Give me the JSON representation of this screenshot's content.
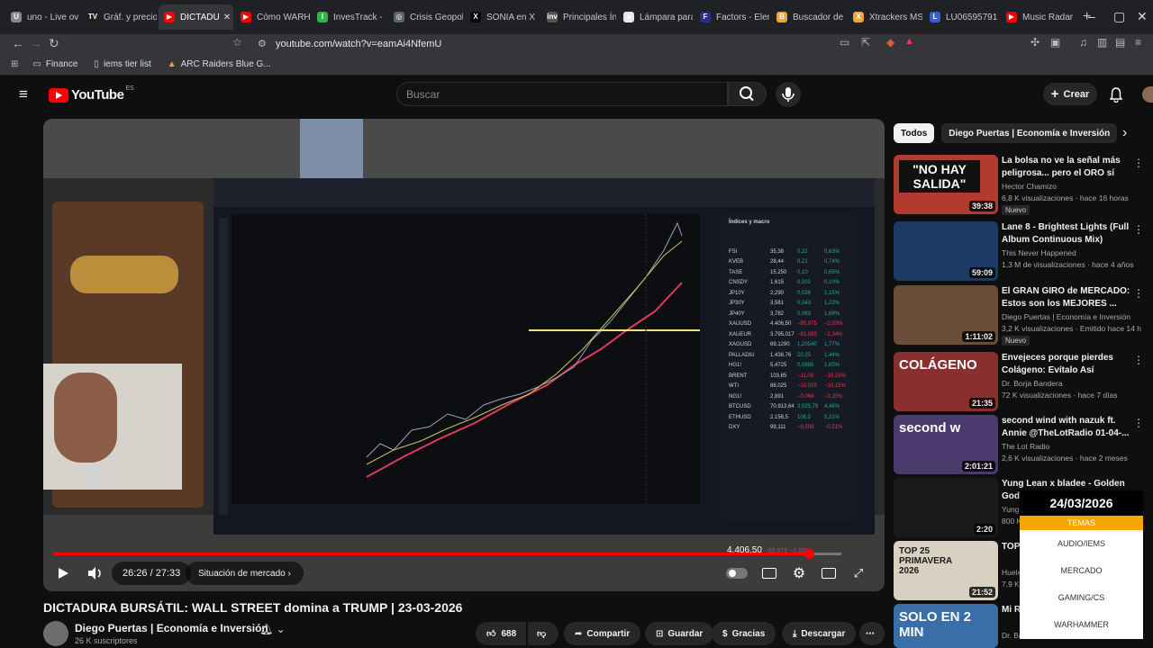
{
  "browser": {
    "tabs": [
      {
        "label": "uno - Live ov",
        "color": "#888888",
        "icon": "U"
      },
      {
        "label": "Gráf. y precio",
        "color": "#1e1e1e",
        "icon": "TV"
      },
      {
        "label": "DICTADU",
        "color": "#ff0000",
        "icon": "▶",
        "active": true
      },
      {
        "label": "Cómo WARH",
        "color": "#ff0000",
        "icon": "▶"
      },
      {
        "label": "InvesTrack -",
        "color": "#2fb34a",
        "icon": "I"
      },
      {
        "label": "Crisis Geopol",
        "color": "#5f6368",
        "icon": "◎"
      },
      {
        "label": "SONIA en X",
        "color": "#000000",
        "icon": "X"
      },
      {
        "label": "Principales Ín",
        "color": "#555555",
        "icon": "inv"
      },
      {
        "label": "Lámpara para",
        "color": "#e8e8e8",
        "icon": "a"
      },
      {
        "label": "Factors - Elem",
        "color": "#2a2f8a",
        "icon": "F"
      },
      {
        "label": "Buscador de",
        "color": "#f2a33a",
        "icon": "B"
      },
      {
        "label": "Xtrackers MS",
        "color": "#f2a33a",
        "icon": "X"
      },
      {
        "label": "LU06595791",
        "color": "#3b5bd6",
        "icon": "L"
      },
      {
        "label": "Music Radar",
        "color": "#ff0000",
        "icon": "▶"
      }
    ],
    "new_tab": "+",
    "minimize": "–",
    "maximize": "▢",
    "close": "✕",
    "url": "youtube.com/watch?v=eamAi4NfemU",
    "bookmarks": [
      "Finance",
      "iems tier list",
      "ARC Raiders Blue G..."
    ]
  },
  "youtube": {
    "logo_text": "YouTube",
    "region": "ES",
    "search_placeholder": "Buscar",
    "create_label": "Crear"
  },
  "player": {
    "current_time": "26:26",
    "duration": "27:33",
    "time_separator": "/",
    "progress": 0.959,
    "chapter": "Situación de mercado",
    "chapter_arrow": "›",
    "screen_price": "4.406,50",
    "screen_change": "−95,975   −2,03%",
    "watchlist_title": "Índices y macro",
    "watchlist": [
      {
        "sym": "FSI",
        "val": "35,38",
        "chg": "0,22",
        "pct": "0,63%"
      },
      {
        "sym": "KVEB",
        "val": "28,44",
        "chg": "0,21",
        "pct": "0,74%"
      },
      {
        "sym": "TASE",
        "val": "15.250",
        "chg": "0,10",
        "pct": "0,65%"
      },
      {
        "sym": "CNSDY",
        "val": "1,615",
        "chg": "0,001",
        "pct": "0,10%"
      },
      {
        "sym": "JP10Y",
        "val": "2,290",
        "chg": "0,026",
        "pct": "1,15%"
      },
      {
        "sym": "JP30Y",
        "val": "3,581",
        "chg": "0,043",
        "pct": "1,22%"
      },
      {
        "sym": "JP40Y",
        "val": "3,782",
        "chg": "0,063",
        "pct": "1,69%"
      },
      {
        "sym": "XAUUSD",
        "val": "4.406,50",
        "chg": "−95,975",
        "pct": "−2,03%"
      },
      {
        "sym": "XAUEUR",
        "val": "3.795,017",
        "chg": "−91,083",
        "pct": "−2,34%"
      },
      {
        "sym": "XAGUSD",
        "val": "69,1290",
        "chg": "1,20540",
        "pct": "1,77%"
      },
      {
        "sym": "PALLADIU",
        "val": "1.438,76",
        "chg": "20,25",
        "pct": "1,44%"
      },
      {
        "sym": "HG1!",
        "val": "5,4725",
        "chg": "0,0885",
        "pct": "1,65%"
      },
      {
        "sym": "BRENT",
        "val": "103,65",
        "chg": "−11,09",
        "pct": "−10,23%"
      },
      {
        "sym": "WTI",
        "val": "88,025",
        "chg": "−10,025",
        "pct": "−10,15%"
      },
      {
        "sym": "NG1!",
        "val": "2,891",
        "chg": "−0,094",
        "pct": "−3,15%"
      },
      {
        "sym": "BTCUSD",
        "val": "70.913,64",
        "chg": "3.025,78",
        "pct": "4,46%"
      },
      {
        "sym": "ETHUSD",
        "val": "2.158,5",
        "chg": "106,5",
        "pct": "5,21%"
      },
      {
        "sym": "DXY",
        "val": "99,111",
        "chg": "−0,509",
        "pct": "−0,51%"
      }
    ]
  },
  "video": {
    "title": "DICTADURA BURSÁTIL: WALL STREET domina a TRUMP | 23-03-2026",
    "channel": "Diego Puertas | Economía e Inversión",
    "subscribers": "26 K suscriptores",
    "likes": "688",
    "share": "Compartir",
    "save": "Guardar",
    "thanks": "Gracias",
    "download": "Descargar",
    "more": "⋯"
  },
  "sidebar": {
    "chips": [
      "Todos",
      "Diego Puertas | Economía e Inversión"
    ],
    "chip_next": "›",
    "recommendations": [
      {
        "title": "La bolsa no ve la señal más peligrosa... pero el ORO sí",
        "channel": "Hector Chamizo",
        "meta": "6,8 K visualizaciones · hace 16 horas",
        "badge": "Nuevo",
        "duration": "39:38",
        "thumb_text": "\"NO HAY SALIDA\"",
        "bg": "#b33a2e"
      },
      {
        "title": "Lane 8 - Brightest Lights (Full Album Continuous Mix)",
        "channel": "This Never Happened",
        "meta": "1,3 M de visualizaciones · hace 4 años",
        "badge": "",
        "duration": "59:09",
        "thumb_text": "",
        "bg": "#1c3a66"
      },
      {
        "title": "El GRAN GIRO de MERCADO: Estos son los MEJORES ...",
        "channel": "Diego Puertas | Economía e Inversión",
        "meta": "3,2 K visualizaciones · Emitido hace 14 h",
        "badge": "Nuevo",
        "duration": "1:11:02",
        "thumb_text": "",
        "bg": "#6b4d3a"
      },
      {
        "title": "Envejeces porque pierdes Colágeno: Evítalo Así",
        "channel": "Dr. Borja Bandera",
        "meta": "72 K visualizaciones · hace 7 días",
        "badge": "",
        "duration": "21:35",
        "thumb_text": "COLÁGENO",
        "bg": "#8a2f2f"
      },
      {
        "title": "second wind with nazuk ft. Annie @TheLotRadio 01-04-...",
        "channel": "The Lot Radio",
        "meta": "2,6 K visualizaciones · hace 2 meses",
        "badge": "",
        "duration": "2:01:21",
        "thumb_text": "second w",
        "bg": "#4a3a6e"
      },
      {
        "title": "Yung Lean x bladee - Golden God",
        "channel": "Yung",
        "meta": "800 K",
        "badge": "",
        "duration": "2:20",
        "thumb_text": "",
        "bg": "#1a1a1a"
      },
      {
        "title": "TOP 25 NICH",
        "channel": "Huele",
        "meta": "7,9 K",
        "badge": "",
        "duration": "21:52",
        "thumb_text": "TOP 25 PRIMAVERA 2026",
        "bg": "#d8d0c0"
      },
      {
        "title": "Mi R PIEL",
        "channel": "Dr. Bo",
        "meta": "",
        "badge": "",
        "duration": "",
        "thumb_text": "SOLO EN 2 MIN",
        "bg": "#3a6ea8"
      }
    ]
  },
  "popup": {
    "date": "24/03/2026",
    "section": "TEMAS",
    "items": [
      "AUDIO/IEMS",
      "MERCADO",
      "GAMING/CS",
      "WARHAMMER"
    ]
  }
}
